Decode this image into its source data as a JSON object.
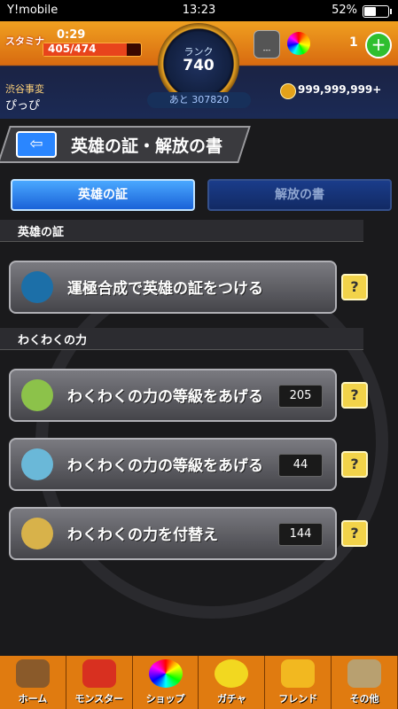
{
  "status": {
    "carrier": "Y!mobile",
    "time": "13:23",
    "battery": "52%"
  },
  "header": {
    "stamina_label": "スタミナ",
    "stamina_time": "0:29",
    "stamina_value": "405/474",
    "rank_label": "ランク",
    "rank_value": "740",
    "next_exp": "あと 307820",
    "orb_count": "1",
    "lock_text": "---",
    "place": "渋谷事変",
    "user_name": "ぴっぴ",
    "coins": "999,999,999+"
  },
  "title": "英雄の証・解放の書",
  "tabs": [
    {
      "label": "英雄の証"
    },
    {
      "label": "解放の書"
    }
  ],
  "sections": [
    {
      "label": "英雄の証"
    },
    {
      "label": "わくわくの力"
    }
  ],
  "items": [
    {
      "label": "運極合成で英雄の証をつける",
      "count": ""
    },
    {
      "label": "わくわくの力の等級をあげる",
      "count": "205"
    },
    {
      "label": "わくわくの力の等級をあげる",
      "count": "44"
    },
    {
      "label": "わくわくの力を付替え",
      "count": "144"
    }
  ],
  "help_label": "?",
  "nav": [
    {
      "label": "ホーム"
    },
    {
      "label": "モンスター"
    },
    {
      "label": "ショップ"
    },
    {
      "label": "ガチャ"
    },
    {
      "label": "フレンド"
    },
    {
      "label": "その他"
    }
  ],
  "colors": {
    "accent": "#e07b10",
    "tab_active": "#1a62d8",
    "help": "#f2d34a"
  }
}
